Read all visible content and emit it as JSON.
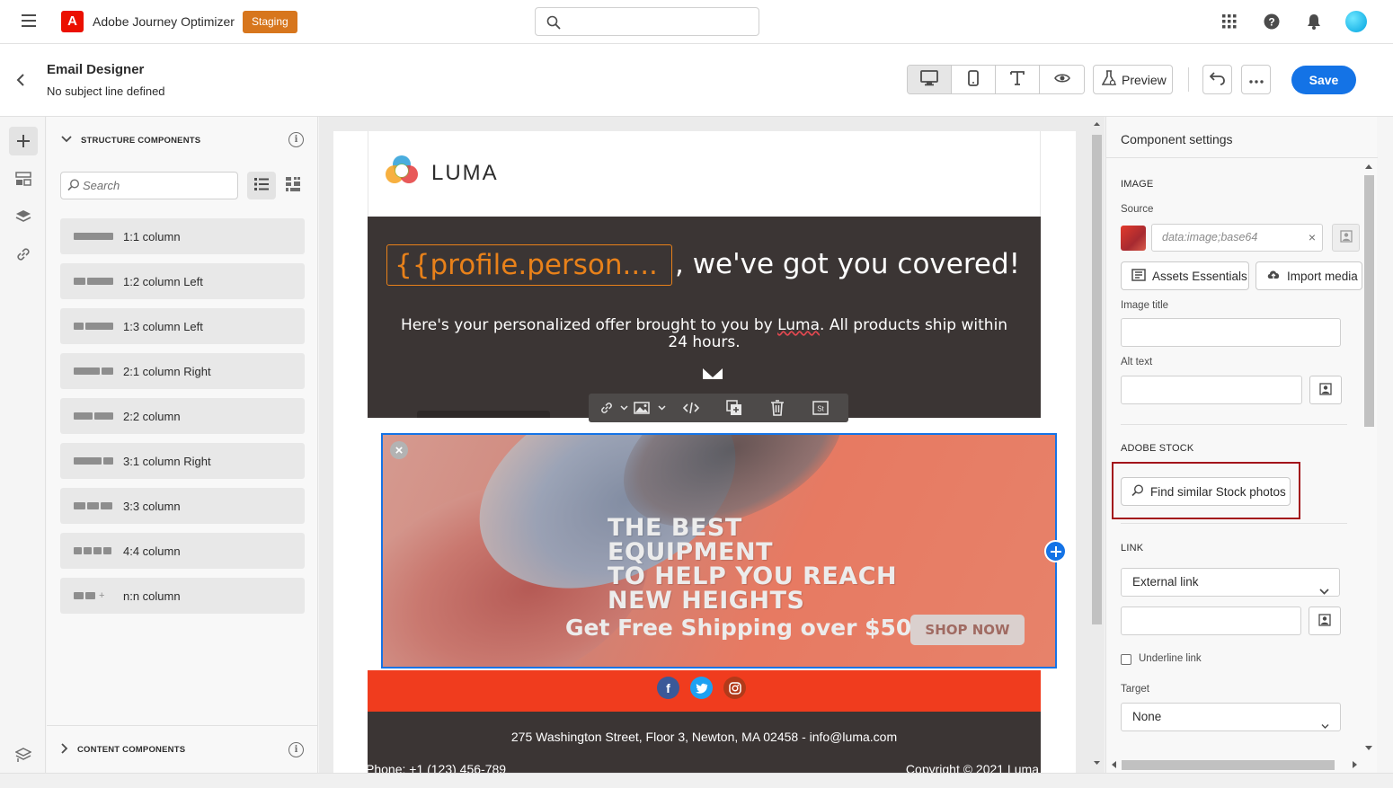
{
  "topbar": {
    "app_title": "Adobe Journey Optimizer",
    "badge": "Staging",
    "search_placeholder": "",
    "icons": [
      "menu-icon",
      "apps-grid-icon",
      "help-icon",
      "notifications-icon",
      "avatar"
    ]
  },
  "header": {
    "title": "Email Designer",
    "subtitle": "No subject line defined",
    "view_buttons": [
      "desktop-icon",
      "mobile-icon",
      "text-icon",
      "eye-icon"
    ],
    "preview_label": "Preview",
    "save_label": "Save"
  },
  "rail": {
    "items": [
      "add-icon",
      "fragments-icon",
      "layers-icon",
      "link-icon",
      "settings-layers-icon"
    ]
  },
  "components": {
    "structure_title": "STRUCTURE COMPONENTS",
    "search_placeholder": "Search",
    "items": [
      {
        "label": "1:1 column"
      },
      {
        "label": "1:2 column Left"
      },
      {
        "label": "1:3 column Left"
      },
      {
        "label": "2:1 column Right"
      },
      {
        "label": "2:2 column"
      },
      {
        "label": "3:1 column Right"
      },
      {
        "label": "3:3 column"
      },
      {
        "label": "4:4 column"
      },
      {
        "label": "n:n column"
      }
    ],
    "content_title": "CONTENT COMPONENTS"
  },
  "email": {
    "logo_text": "LUMA",
    "token": "{{profile.person....",
    "headline_rest": ", we've got you covered!",
    "offer_before": "Here's your personalized offer brought to you by ",
    "offer_luma": "Luma",
    "offer_after": ". All products ship within 24 hours.",
    "promo_headline_1": "THE BEST EQUIPMENT",
    "promo_headline_2": "TO HELP YOU REACH",
    "promo_headline_3": "NEW HEIGHTS",
    "promo_shipping": "Get Free Shipping over $50",
    "promo_button": "SHOP NOW",
    "social": [
      "facebook-icon",
      "twitter-icon",
      "instagram-icon"
    ],
    "footer_address": "275 Washington Street, Floor 3, Newton, MA 02458 - info@luma.com",
    "footer_phone": "Phone: +1 (123) 456-789",
    "footer_copyright": "Copyright © 2021 Luma"
  },
  "settings": {
    "title": "Component settings",
    "image_section": "IMAGE",
    "source_label": "Source",
    "source_value": "data:image;base64",
    "assets_button": "Assets Essentials",
    "import_button": "Import media",
    "image_title_label": "Image title",
    "alt_text_label": "Alt text",
    "stock_section": "ADOBE STOCK",
    "stock_button": "Find similar Stock photos",
    "link_section": "LINK",
    "link_type": "External link",
    "underline_label": "Underline link",
    "target_label": "Target",
    "target_value": "None"
  },
  "colors": {
    "accent": "#1473e6",
    "staging": "#d7761d",
    "email_dark": "#3b3534",
    "token_orange": "#e8811a",
    "social_bar": "#f03c1e",
    "highlight": "#a3141b"
  }
}
